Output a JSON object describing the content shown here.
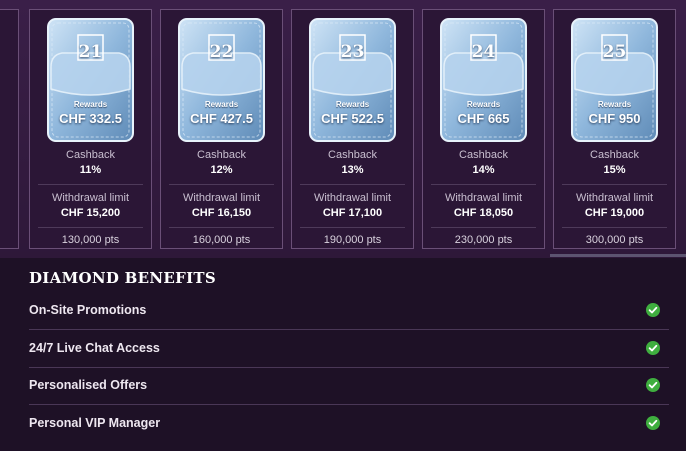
{
  "tiers": [
    {
      "level": "21",
      "rewards_label": "Rewards",
      "rewards": "CHF 332.5",
      "cashback_label": "Cashback",
      "cashback": "11%",
      "withdrawal_label": "Withdrawal limit",
      "withdrawal": "CHF 15,200",
      "points": "130,000 pts"
    },
    {
      "level": "22",
      "rewards_label": "Rewards",
      "rewards": "CHF 427.5",
      "cashback_label": "Cashback",
      "cashback": "12%",
      "withdrawal_label": "Withdrawal limit",
      "withdrawal": "CHF 16,150",
      "points": "160,000 pts"
    },
    {
      "level": "23",
      "rewards_label": "Rewards",
      "rewards": "CHF 522.5",
      "cashback_label": "Cashback",
      "cashback": "13%",
      "withdrawal_label": "Withdrawal limit",
      "withdrawal": "CHF 17,100",
      "points": "190,000 pts"
    },
    {
      "level": "24",
      "rewards_label": "Rewards",
      "rewards": "CHF 665",
      "cashback_label": "Cashback",
      "cashback": "14%",
      "withdrawal_label": "Withdrawal limit",
      "withdrawal": "CHF 18,050",
      "points": "230,000 pts"
    },
    {
      "level": "25",
      "rewards_label": "Rewards",
      "rewards": "CHF 950",
      "cashback_label": "Cashback",
      "cashback": "15%",
      "withdrawal_label": "Withdrawal limit",
      "withdrawal": "CHF 19,000",
      "points": "300,000 pts"
    }
  ],
  "benefits": {
    "title": "DIAMOND BENEFITS",
    "items": [
      {
        "label": "On-Site Promotions",
        "icon": "check-icon"
      },
      {
        "label": "24/7 Live Chat Access",
        "icon": "check-icon"
      },
      {
        "label": "Personalised Offers",
        "icon": "check-icon"
      },
      {
        "label": "Personal VIP Manager",
        "icon": "check-icon"
      }
    ]
  },
  "colors": {
    "background": "#1e1126",
    "card_background": "#2b1636",
    "card_border": "#6a4f77",
    "wallet_blue": "#9fc4e6",
    "check_green": "#3fae3f"
  }
}
